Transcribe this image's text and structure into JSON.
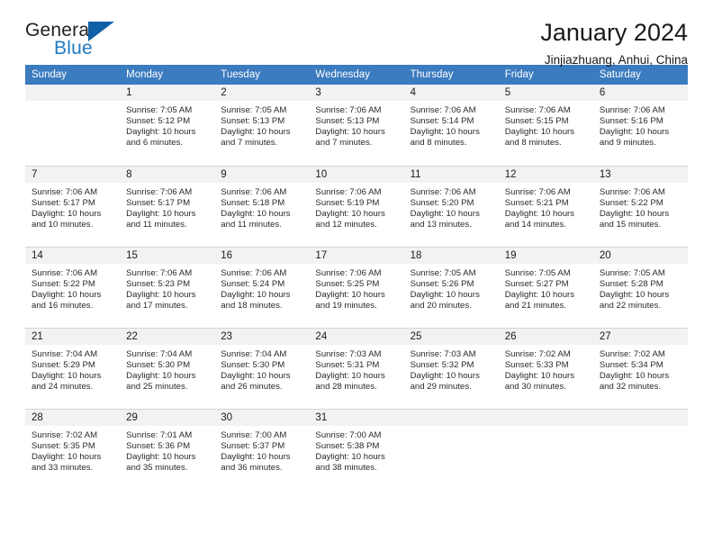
{
  "branding": {
    "logo_text_primary": "General",
    "logo_text_secondary": "Blue",
    "logo_mark": "blue-triangle-icon",
    "accent_color": "#1f7bc1",
    "mark_color": "#1060a8"
  },
  "header": {
    "title": "January 2024",
    "subtitle": "Jinjiazhuang, Anhui, China"
  },
  "calendar": {
    "header_background": "#3b7bbf",
    "daynum_background": "#f2f2f2",
    "weekday_headers": [
      "Sunday",
      "Monday",
      "Tuesday",
      "Wednesday",
      "Thursday",
      "Friday",
      "Saturday"
    ],
    "weeks": [
      [
        {
          "day": "",
          "blank": true,
          "sunrise": "",
          "sunset": "",
          "daylight_line1": "",
          "daylight_line2": ""
        },
        {
          "day": "1",
          "blank": false,
          "sunrise": "Sunrise: 7:05 AM",
          "sunset": "Sunset: 5:12 PM",
          "daylight_line1": "Daylight: 10 hours",
          "daylight_line2": "and 6 minutes."
        },
        {
          "day": "2",
          "blank": false,
          "sunrise": "Sunrise: 7:05 AM",
          "sunset": "Sunset: 5:13 PM",
          "daylight_line1": "Daylight: 10 hours",
          "daylight_line2": "and 7 minutes."
        },
        {
          "day": "3",
          "blank": false,
          "sunrise": "Sunrise: 7:06 AM",
          "sunset": "Sunset: 5:13 PM",
          "daylight_line1": "Daylight: 10 hours",
          "daylight_line2": "and 7 minutes."
        },
        {
          "day": "4",
          "blank": false,
          "sunrise": "Sunrise: 7:06 AM",
          "sunset": "Sunset: 5:14 PM",
          "daylight_line1": "Daylight: 10 hours",
          "daylight_line2": "and 8 minutes."
        },
        {
          "day": "5",
          "blank": false,
          "sunrise": "Sunrise: 7:06 AM",
          "sunset": "Sunset: 5:15 PM",
          "daylight_line1": "Daylight: 10 hours",
          "daylight_line2": "and 8 minutes."
        },
        {
          "day": "6",
          "blank": false,
          "sunrise": "Sunrise: 7:06 AM",
          "sunset": "Sunset: 5:16 PM",
          "daylight_line1": "Daylight: 10 hours",
          "daylight_line2": "and 9 minutes."
        }
      ],
      [
        {
          "day": "7",
          "blank": false,
          "sunrise": "Sunrise: 7:06 AM",
          "sunset": "Sunset: 5:17 PM",
          "daylight_line1": "Daylight: 10 hours",
          "daylight_line2": "and 10 minutes."
        },
        {
          "day": "8",
          "blank": false,
          "sunrise": "Sunrise: 7:06 AM",
          "sunset": "Sunset: 5:17 PM",
          "daylight_line1": "Daylight: 10 hours",
          "daylight_line2": "and 11 minutes."
        },
        {
          "day": "9",
          "blank": false,
          "sunrise": "Sunrise: 7:06 AM",
          "sunset": "Sunset: 5:18 PM",
          "daylight_line1": "Daylight: 10 hours",
          "daylight_line2": "and 11 minutes."
        },
        {
          "day": "10",
          "blank": false,
          "sunrise": "Sunrise: 7:06 AM",
          "sunset": "Sunset: 5:19 PM",
          "daylight_line1": "Daylight: 10 hours",
          "daylight_line2": "and 12 minutes."
        },
        {
          "day": "11",
          "blank": false,
          "sunrise": "Sunrise: 7:06 AM",
          "sunset": "Sunset: 5:20 PM",
          "daylight_line1": "Daylight: 10 hours",
          "daylight_line2": "and 13 minutes."
        },
        {
          "day": "12",
          "blank": false,
          "sunrise": "Sunrise: 7:06 AM",
          "sunset": "Sunset: 5:21 PM",
          "daylight_line1": "Daylight: 10 hours",
          "daylight_line2": "and 14 minutes."
        },
        {
          "day": "13",
          "blank": false,
          "sunrise": "Sunrise: 7:06 AM",
          "sunset": "Sunset: 5:22 PM",
          "daylight_line1": "Daylight: 10 hours",
          "daylight_line2": "and 15 minutes."
        }
      ],
      [
        {
          "day": "14",
          "blank": false,
          "sunrise": "Sunrise: 7:06 AM",
          "sunset": "Sunset: 5:22 PM",
          "daylight_line1": "Daylight: 10 hours",
          "daylight_line2": "and 16 minutes."
        },
        {
          "day": "15",
          "blank": false,
          "sunrise": "Sunrise: 7:06 AM",
          "sunset": "Sunset: 5:23 PM",
          "daylight_line1": "Daylight: 10 hours",
          "daylight_line2": "and 17 minutes."
        },
        {
          "day": "16",
          "blank": false,
          "sunrise": "Sunrise: 7:06 AM",
          "sunset": "Sunset: 5:24 PM",
          "daylight_line1": "Daylight: 10 hours",
          "daylight_line2": "and 18 minutes."
        },
        {
          "day": "17",
          "blank": false,
          "sunrise": "Sunrise: 7:06 AM",
          "sunset": "Sunset: 5:25 PM",
          "daylight_line1": "Daylight: 10 hours",
          "daylight_line2": "and 19 minutes."
        },
        {
          "day": "18",
          "blank": false,
          "sunrise": "Sunrise: 7:05 AM",
          "sunset": "Sunset: 5:26 PM",
          "daylight_line1": "Daylight: 10 hours",
          "daylight_line2": "and 20 minutes."
        },
        {
          "day": "19",
          "blank": false,
          "sunrise": "Sunrise: 7:05 AM",
          "sunset": "Sunset: 5:27 PM",
          "daylight_line1": "Daylight: 10 hours",
          "daylight_line2": "and 21 minutes."
        },
        {
          "day": "20",
          "blank": false,
          "sunrise": "Sunrise: 7:05 AM",
          "sunset": "Sunset: 5:28 PM",
          "daylight_line1": "Daylight: 10 hours",
          "daylight_line2": "and 22 minutes."
        }
      ],
      [
        {
          "day": "21",
          "blank": false,
          "sunrise": "Sunrise: 7:04 AM",
          "sunset": "Sunset: 5:29 PM",
          "daylight_line1": "Daylight: 10 hours",
          "daylight_line2": "and 24 minutes."
        },
        {
          "day": "22",
          "blank": false,
          "sunrise": "Sunrise: 7:04 AM",
          "sunset": "Sunset: 5:30 PM",
          "daylight_line1": "Daylight: 10 hours",
          "daylight_line2": "and 25 minutes."
        },
        {
          "day": "23",
          "blank": false,
          "sunrise": "Sunrise: 7:04 AM",
          "sunset": "Sunset: 5:30 PM",
          "daylight_line1": "Daylight: 10 hours",
          "daylight_line2": "and 26 minutes."
        },
        {
          "day": "24",
          "blank": false,
          "sunrise": "Sunrise: 7:03 AM",
          "sunset": "Sunset: 5:31 PM",
          "daylight_line1": "Daylight: 10 hours",
          "daylight_line2": "and 28 minutes."
        },
        {
          "day": "25",
          "blank": false,
          "sunrise": "Sunrise: 7:03 AM",
          "sunset": "Sunset: 5:32 PM",
          "daylight_line1": "Daylight: 10 hours",
          "daylight_line2": "and 29 minutes."
        },
        {
          "day": "26",
          "blank": false,
          "sunrise": "Sunrise: 7:02 AM",
          "sunset": "Sunset: 5:33 PM",
          "daylight_line1": "Daylight: 10 hours",
          "daylight_line2": "and 30 minutes."
        },
        {
          "day": "27",
          "blank": false,
          "sunrise": "Sunrise: 7:02 AM",
          "sunset": "Sunset: 5:34 PM",
          "daylight_line1": "Daylight: 10 hours",
          "daylight_line2": "and 32 minutes."
        }
      ],
      [
        {
          "day": "28",
          "blank": false,
          "sunrise": "Sunrise: 7:02 AM",
          "sunset": "Sunset: 5:35 PM",
          "daylight_line1": "Daylight: 10 hours",
          "daylight_line2": "and 33 minutes."
        },
        {
          "day": "29",
          "blank": false,
          "sunrise": "Sunrise: 7:01 AM",
          "sunset": "Sunset: 5:36 PM",
          "daylight_line1": "Daylight: 10 hours",
          "daylight_line2": "and 35 minutes."
        },
        {
          "day": "30",
          "blank": false,
          "sunrise": "Sunrise: 7:00 AM",
          "sunset": "Sunset: 5:37 PM",
          "daylight_line1": "Daylight: 10 hours",
          "daylight_line2": "and 36 minutes."
        },
        {
          "day": "31",
          "blank": false,
          "sunrise": "Sunrise: 7:00 AM",
          "sunset": "Sunset: 5:38 PM",
          "daylight_line1": "Daylight: 10 hours",
          "daylight_line2": "and 38 minutes."
        },
        {
          "day": "",
          "blank": true,
          "sunrise": "",
          "sunset": "",
          "daylight_line1": "",
          "daylight_line2": ""
        },
        {
          "day": "",
          "blank": true,
          "sunrise": "",
          "sunset": "",
          "daylight_line1": "",
          "daylight_line2": ""
        },
        {
          "day": "",
          "blank": true,
          "sunrise": "",
          "sunset": "",
          "daylight_line1": "",
          "daylight_line2": ""
        }
      ]
    ]
  }
}
